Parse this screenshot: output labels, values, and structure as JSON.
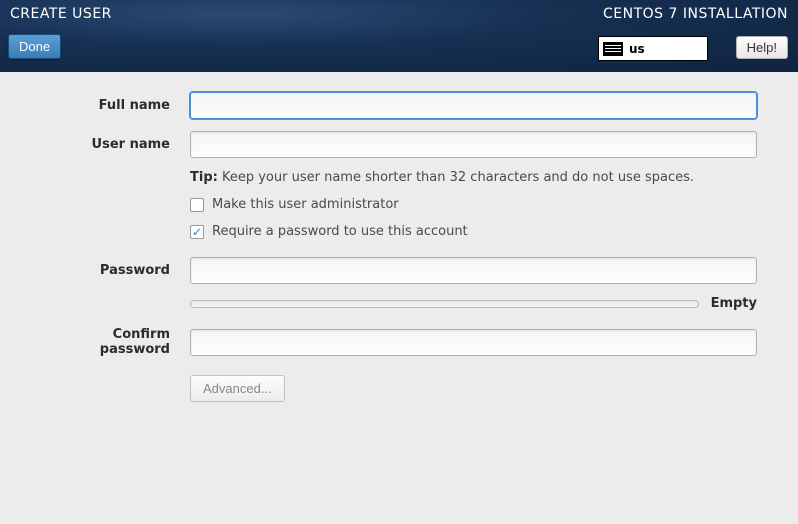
{
  "header": {
    "title": "CREATE USER",
    "installation_label": "CENTOS 7 INSTALLATION",
    "done_label": "Done",
    "help_label": "Help!",
    "keyboard_layout": "us"
  },
  "form": {
    "full_name": {
      "label": "Full name",
      "value": ""
    },
    "user_name": {
      "label": "User name",
      "value": ""
    },
    "tip_label": "Tip:",
    "tip_text": "Keep your user name shorter than 32 characters and do not use spaces.",
    "admin_checkbox": {
      "label": "Make this user administrator",
      "checked": false
    },
    "require_password_checkbox": {
      "label": "Require a password to use this account",
      "checked": true
    },
    "password": {
      "label": "Password",
      "value": ""
    },
    "strength_label": "Empty",
    "confirm_password": {
      "label": "Confirm password",
      "value": ""
    },
    "advanced_label": "Advanced..."
  }
}
